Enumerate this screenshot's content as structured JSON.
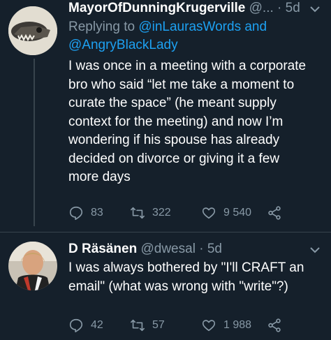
{
  "tweets": [
    {
      "display_name": "MayorOfDunningKrugerville",
      "handle": "@...",
      "separator": "·",
      "time": "5d",
      "reply_prefix": "Replying to ",
      "reply_mention_1": "@inLaurasWords",
      "reply_and": " and",
      "reply_mention_2": "@AngryBlackLady",
      "text_lines": [
        "I was once in a meeting with a corporate",
        "bro who said “let me take a moment to",
        "curate the space” (he meant supply",
        "context for the meeting) and now I’m",
        "wondering if his spouse has already",
        "decided on divorce or giving it a few",
        "more days"
      ],
      "replies": "83",
      "retweets": "322",
      "likes": "9 540"
    },
    {
      "display_name": "D Räsänen",
      "handle": "@dwesal",
      "separator": "·",
      "time": "5d",
      "text_lines": [
        "I was always bothered by \"I'll CRAFT an",
        "email\" (what was wrong with \"write\"?)"
      ],
      "replies": "42",
      "retweets": "57",
      "likes": "1 988"
    }
  ],
  "colors": {
    "background": "#15202b",
    "muted": "#8899a6",
    "link": "#1da1f2",
    "divider": "#38444d"
  },
  "icons": [
    "reply-icon",
    "retweet-icon",
    "like-icon",
    "share-icon",
    "chevron-down-icon"
  ]
}
